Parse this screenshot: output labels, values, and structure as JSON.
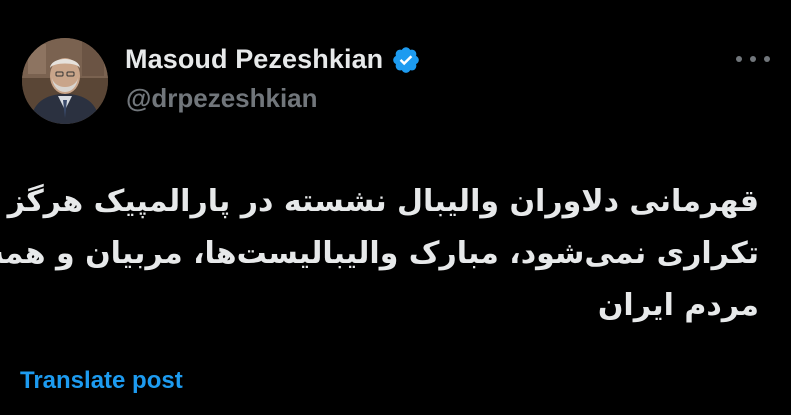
{
  "user": {
    "display_name": "Masoud Pezeshkian",
    "handle": "@drpezeshkian",
    "verified_icon": "verified-badge-icon",
    "avatar": "profile-photo"
  },
  "menu": {
    "more_icon": "more-options-icon"
  },
  "tweet": {
    "lines": [
      "قهرمانی دلاوران والیبال نشسته در پارالمپیک هرگز",
      "تکراری نمی‌شود، مبارک والیبالیست‌ها، مربیان و همه",
      "مردم ایران"
    ]
  },
  "actions": {
    "translate_label": "Translate post"
  },
  "colors": {
    "background": "#000000",
    "text_primary": "#e7e9ea",
    "text_secondary": "#71767b",
    "accent": "#1d9bf0"
  }
}
